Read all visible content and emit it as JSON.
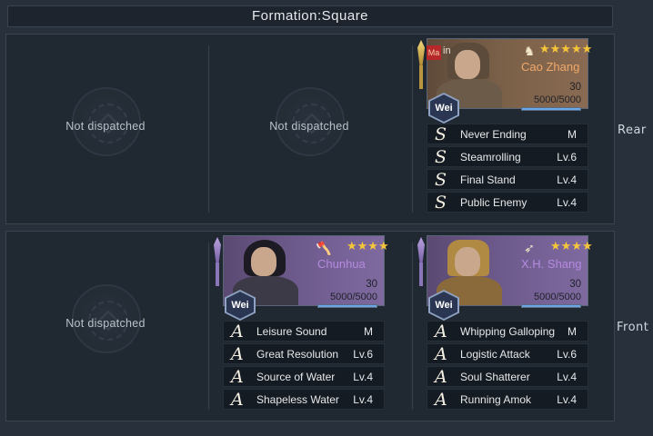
{
  "formation_title": "Formation:Square",
  "rows": {
    "rear_label": "Rear",
    "front_label": "Front"
  },
  "empty_slot_text": "Not dispatched",
  "generals": {
    "cao_zhang": {
      "main_tag": "Ma",
      "main_tag_text": "in",
      "name": "Cao Zhang",
      "stars": "★★★★★",
      "level": "30",
      "troops": "5000/5000",
      "troop_fraction": 1.0,
      "faction": "Wei",
      "skills": [
        {
          "grade": "S",
          "name": "Never Ending",
          "level": "M"
        },
        {
          "grade": "S",
          "name": "Steamrolling",
          "level": "Lv.6"
        },
        {
          "grade": "S",
          "name": "Final Stand",
          "level": "Lv.4"
        },
        {
          "grade": "S",
          "name": "Public Enemy",
          "level": "Lv.4"
        }
      ]
    },
    "chunhua": {
      "name": "Chunhua",
      "stars": "★★★★",
      "level": "30",
      "troops": "5000/5000",
      "troop_fraction": 1.0,
      "faction": "Wei",
      "skills": [
        {
          "grade": "A",
          "name": "Leisure Sound",
          "level": "M"
        },
        {
          "grade": "A",
          "name": "Great Resolution",
          "level": "Lv.6"
        },
        {
          "grade": "A",
          "name": "Source of Water",
          "level": "Lv.4"
        },
        {
          "grade": "A",
          "name": "Shapeless Water",
          "level": "Lv.4"
        }
      ]
    },
    "xh_shang": {
      "name": "X.H. Shang",
      "stars": "★★★★",
      "level": "30",
      "troops": "5000/5000",
      "troop_fraction": 1.0,
      "faction": "Wei",
      "skills": [
        {
          "grade": "A",
          "name": "Whipping Galloping",
          "level": "M"
        },
        {
          "grade": "A",
          "name": "Logistic Attack",
          "level": "Lv.6"
        },
        {
          "grade": "A",
          "name": "Soul Shatterer",
          "level": "Lv.4"
        },
        {
          "grade": "A",
          "name": "Running Amok",
          "level": "Lv.4"
        }
      ]
    }
  },
  "icons": {
    "star": "star-icon",
    "cavalry": "cavalry-icon",
    "axe": "axe-icon",
    "archer": "archer-icon"
  },
  "colors": {
    "name_orange": "#f0a868",
    "star_gold": "#f5c53a",
    "troop_bar": "#6aa8e8"
  }
}
